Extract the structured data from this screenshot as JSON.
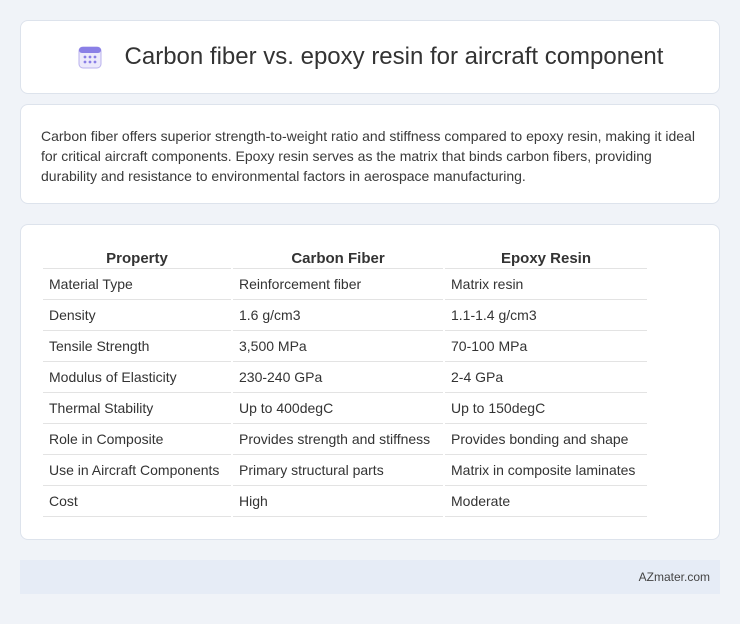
{
  "header": {
    "title": "Carbon fiber vs. epoxy resin for aircraft component",
    "icon": "calendar-icon",
    "icon_color": "#8a7fe6"
  },
  "description": {
    "text": "Carbon fiber offers superior strength-to-weight ratio and stiffness compared to epoxy resin, making it ideal for critical aircraft components. Epoxy resin serves as the matrix that binds carbon fibers, providing durability and resistance to environmental factors in aerospace manufacturing."
  },
  "table": {
    "headers": [
      "Property",
      "Carbon Fiber",
      "Epoxy Resin"
    ],
    "rows": [
      [
        "Material Type",
        "Reinforcement fiber",
        "Matrix resin"
      ],
      [
        "Density",
        "1.6 g/cm3",
        "1.1-1.4 g/cm3"
      ],
      [
        "Tensile Strength",
        "3,500 MPa",
        "70-100 MPa"
      ],
      [
        "Modulus of Elasticity",
        "230-240 GPa",
        "2-4 GPa"
      ],
      [
        "Thermal Stability",
        "Up to 400degC",
        "Up to 150degC"
      ],
      [
        "Role in Composite",
        "Provides strength and stiffness",
        "Provides bonding and shape"
      ],
      [
        "Use in Aircraft Components",
        "Primary structural parts",
        "Matrix in composite laminates"
      ],
      [
        "Cost",
        "High",
        "Moderate"
      ]
    ]
  },
  "footer": {
    "site": "AZmater.com"
  }
}
